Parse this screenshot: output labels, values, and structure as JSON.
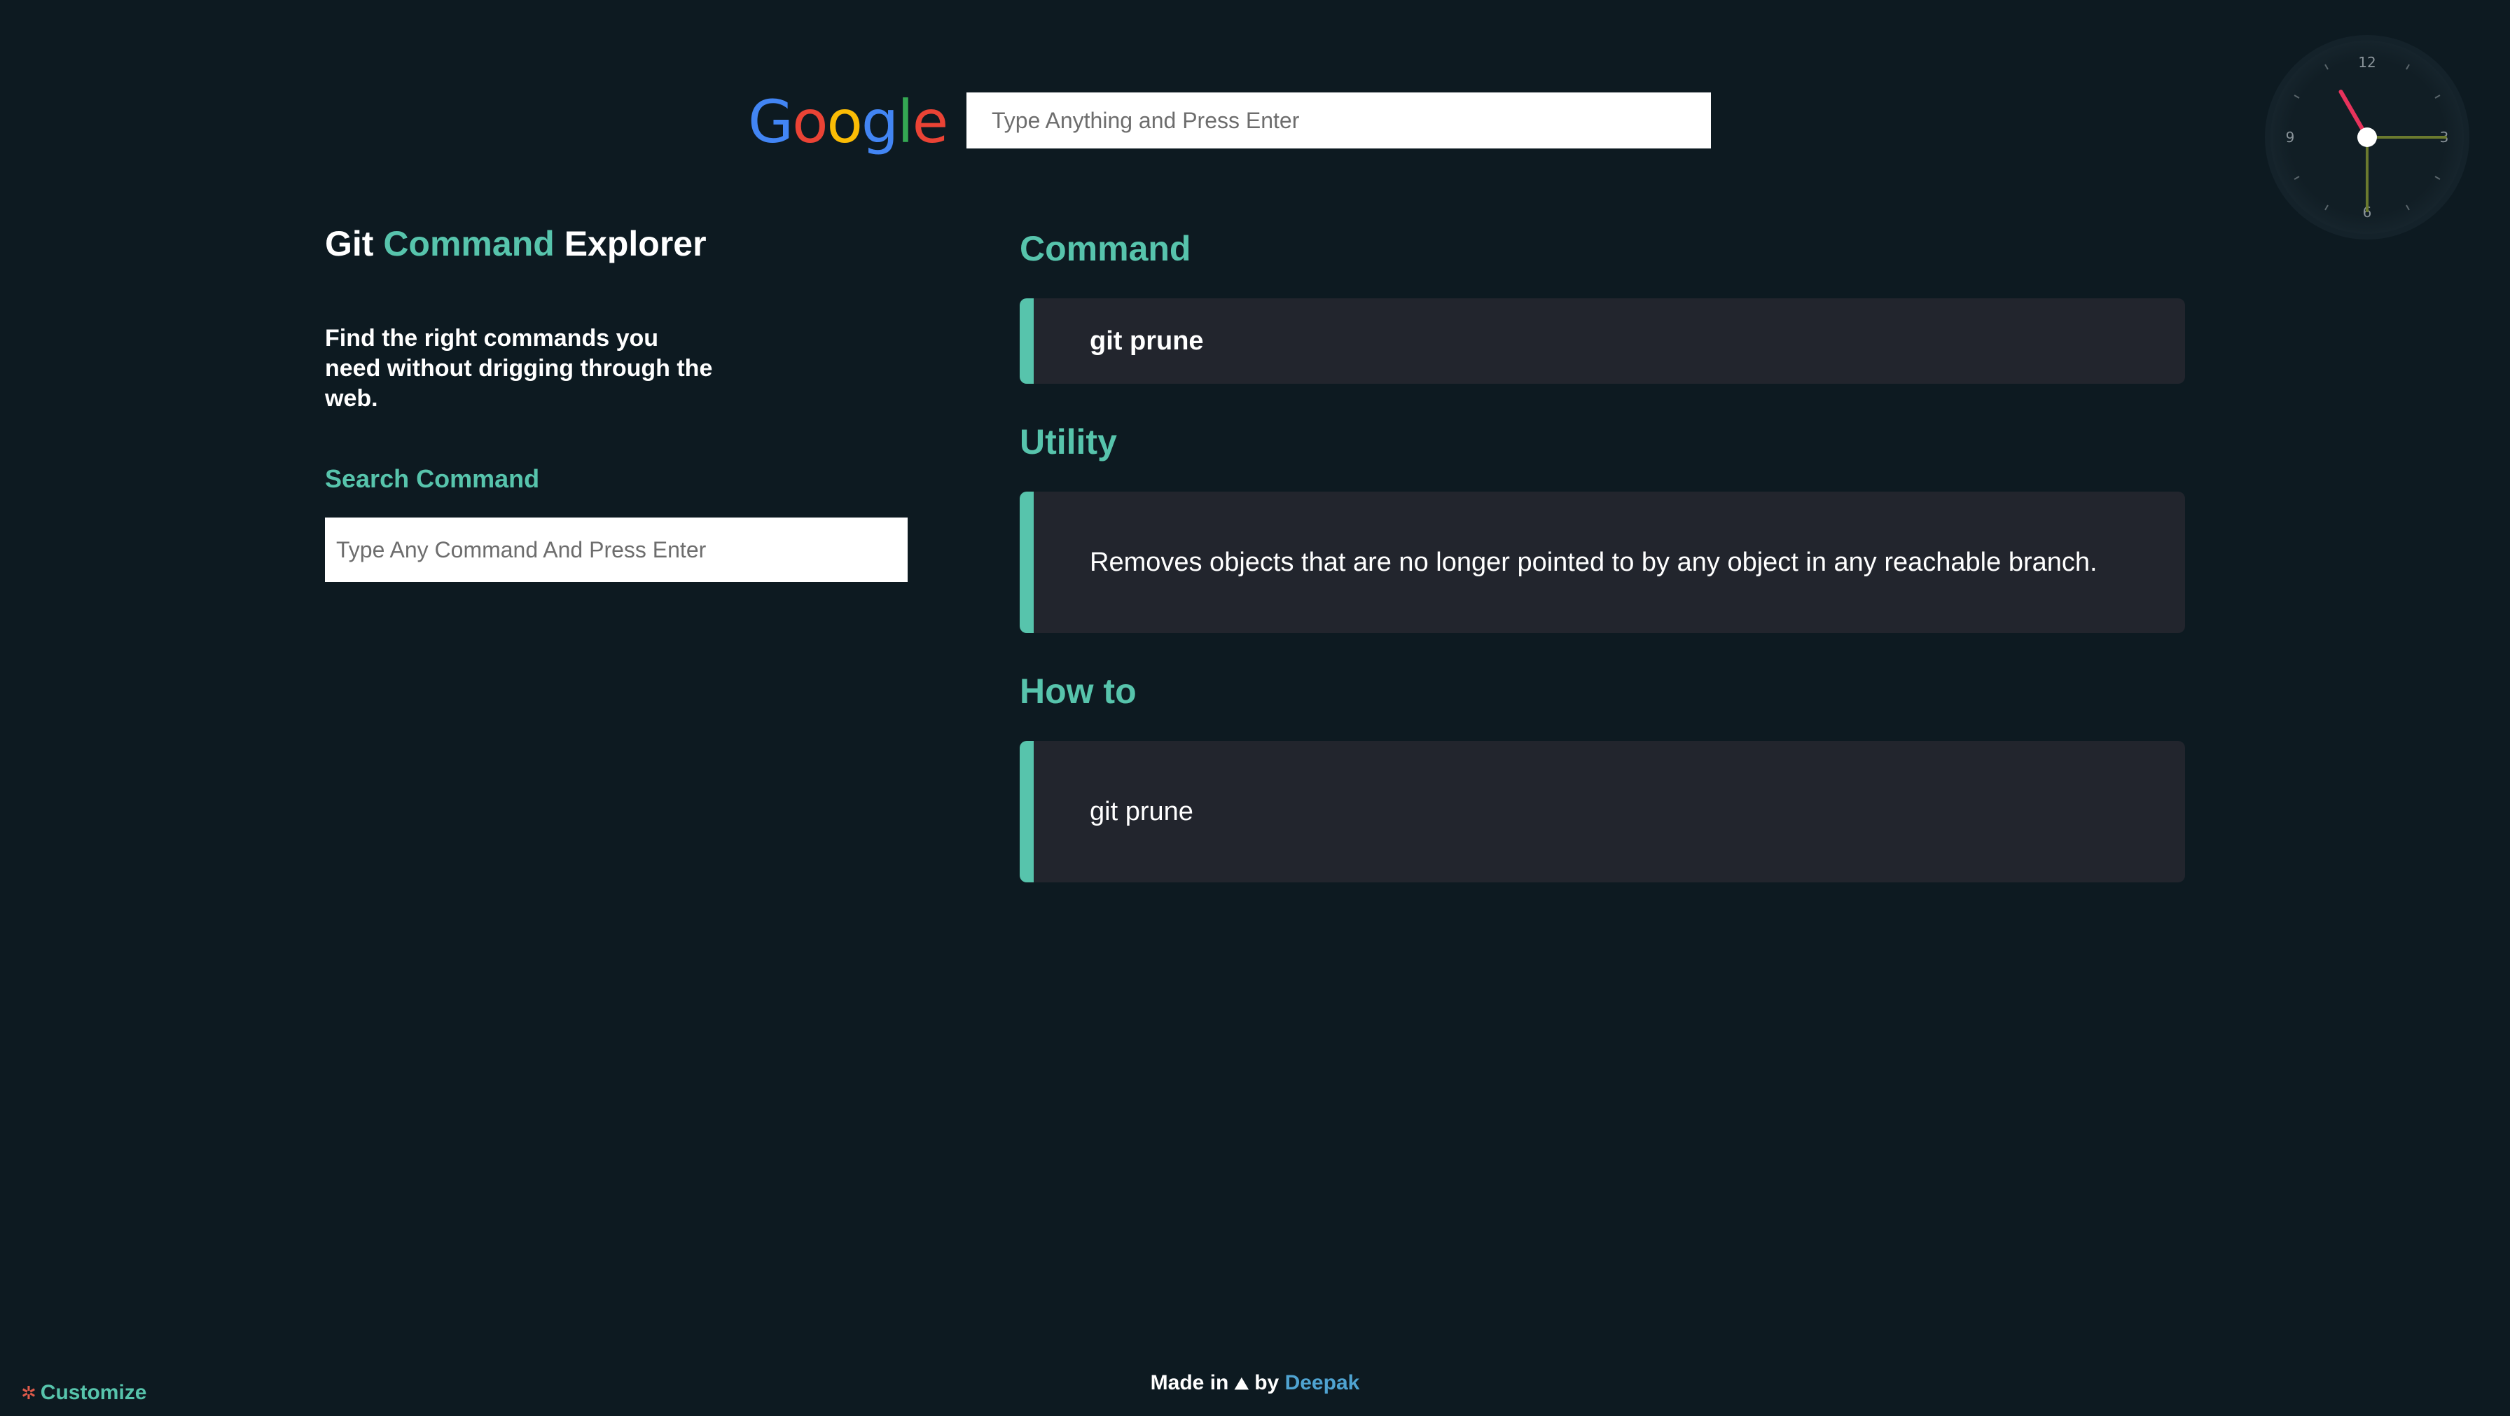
{
  "google": {
    "logo_letters": [
      {
        "ch": "G",
        "color": "#4285F4"
      },
      {
        "ch": "o",
        "color": "#EA4335"
      },
      {
        "ch": "o",
        "color": "#FBBC05"
      },
      {
        "ch": "g",
        "color": "#4285F4"
      },
      {
        "ch": "l",
        "color": "#34A853"
      },
      {
        "ch": "e",
        "color": "#EA4335"
      }
    ],
    "search_placeholder": "Type Anything and Press Enter"
  },
  "explorer": {
    "title_prefix": "Git ",
    "title_accent": "Command",
    "title_suffix": " Explorer",
    "tagline": "Find the right commands you need without drigging through the web.",
    "search_label": "Search Command",
    "search_placeholder": "Type Any Command And Press Enter"
  },
  "result": {
    "command_heading": "Command",
    "command_value": "git prune",
    "utility_heading": "Utility",
    "utility_value": "Removes objects that are no longer pointed to by any object in any reachable branch.",
    "howto_heading": "How to",
    "howto_value": "git prune"
  },
  "clock": {
    "labels": [
      "12",
      "3",
      "6",
      "9"
    ],
    "hour": 11,
    "minute": 30,
    "second": 15,
    "colors": {
      "hour": "#e8335c",
      "minute": "#6b7a2e",
      "second": "#6b7a2e"
    }
  },
  "footer": {
    "made_in": "Made in",
    "flag_icon": "⛰",
    "by": "by",
    "author": "Deepak"
  },
  "customize": {
    "icon": "✲",
    "label": "Customize"
  }
}
